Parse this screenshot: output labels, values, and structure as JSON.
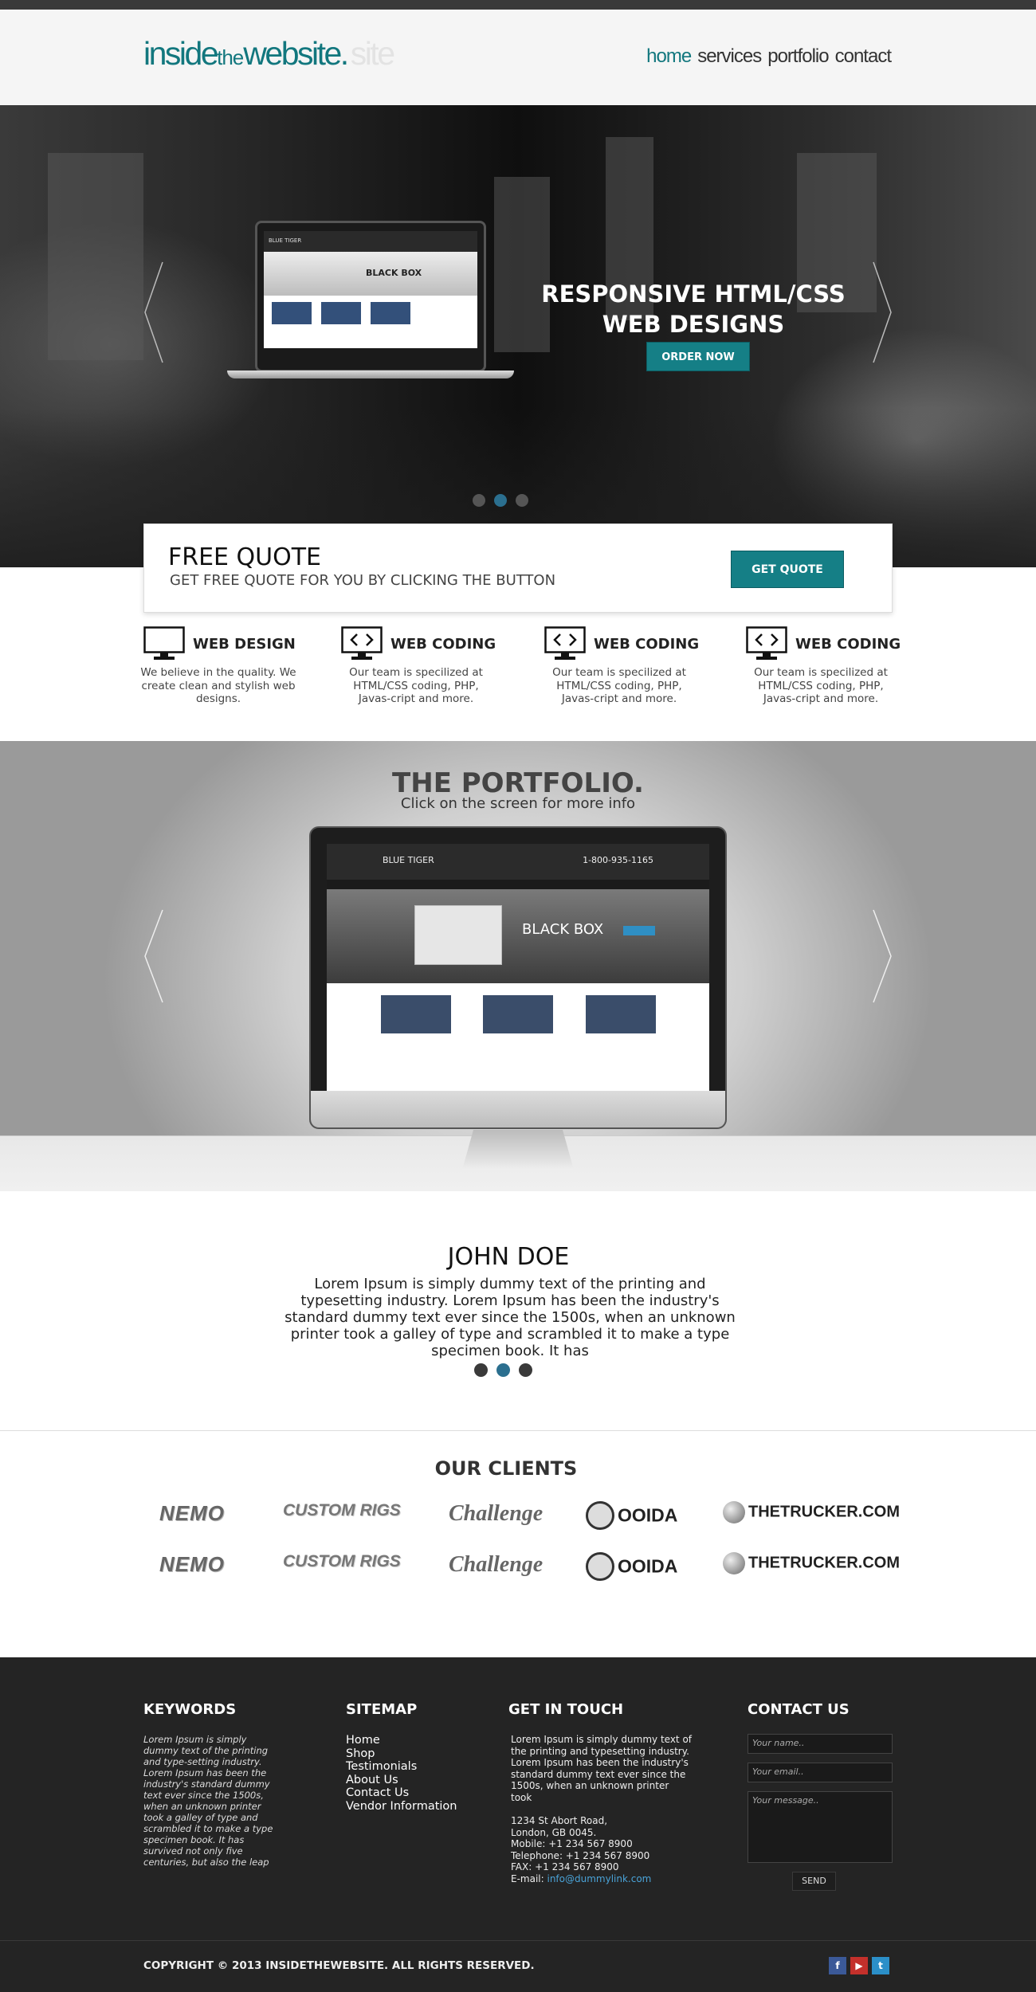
{
  "header": {
    "logo": {
      "part1": "inside",
      "part2": "the",
      "part3": "website.",
      "ghost": "site"
    },
    "nav": [
      "home",
      "services",
      "portfolio",
      "contact"
    ]
  },
  "hero": {
    "title_line1": "RESPONSIVE HTML/CSS",
    "title_line2": "WEB DESIGNS",
    "button": "ORDER NOW",
    "laptop_brand": "BLUE TIGER",
    "laptop_banner": "BLACK BOX"
  },
  "quote": {
    "title": "FREE QUOTE",
    "subtitle": "GET FREE QUOTE FOR YOU BY CLICKING THE BUTTON",
    "button": "GET QUOTE"
  },
  "services": [
    {
      "title": "WEB DESIGN",
      "text": "We believe in the quality. We create clean and stylish web designs.",
      "icon": "monitor-icon"
    },
    {
      "title": "WEB CODING",
      "text": "Our team is specilized at HTML/CSS coding, PHP, Javas-cript and more.",
      "icon": "code-monitor-icon"
    },
    {
      "title": "WEB CODING",
      "text": "Our team is specilized at HTML/CSS coding, PHP, Javas-cript and more.",
      "icon": "code-monitor-icon"
    },
    {
      "title": "WEB CODING",
      "text": "Our team is specilized at HTML/CSS coding, PHP, Javas-cript and more.",
      "icon": "code-monitor-icon"
    }
  ],
  "portfolio": {
    "title": "THE PORTFOLIO.",
    "subtitle": "Click on the screen for more info",
    "screen_brand": "BLUE TIGER",
    "screen_phone": "1-800-935-1165",
    "screen_banner": "BLACK BOX"
  },
  "testimonial": {
    "name": "JOHN DOE",
    "text": "Lorem Ipsum is simply dummy text of the printing and typesetting industry. Lorem Ipsum has been the industry's standard dummy text ever since the 1500s, when an unknown printer took a galley of type and scrambled it to make a type specimen book. It has"
  },
  "clients": {
    "title": "OUR CLIENTS",
    "logos": [
      "NEMO",
      "CUSTOM RIGS",
      "Challenge",
      "OOIDA",
      "THETRUCKER.COM"
    ]
  },
  "footer": {
    "keywords": {
      "title": "KEYWORDS",
      "text": "Lorem Ipsum is simply dummy text of the printing and type-setting industry. Lorem Ipsum has been the industry's standard dummy text ever since the 1500s, when an unknown printer took a galley of type and scrambled it to make a type specimen book. It has survived not only five centuries, but also the leap"
    },
    "sitemap": {
      "title": "SITEMAP",
      "links": [
        "Home",
        "Shop",
        "Testimonials",
        "About Us",
        "Contact Us",
        "Vendor Information"
      ]
    },
    "touch": {
      "title": "GET IN TOUCH",
      "text": "Lorem Ipsum is simply dummy text of the printing and typesetting industry. Lorem Ipsum has been the industry's standard dummy text ever since the 1500s, when an unknown printer took",
      "address1": "1234 St Abort Road,",
      "address2": "London, GB 0045.",
      "mobile": "Mobile: +1 234 567 8900",
      "telephone": "Telephone: +1 234 567 8900",
      "fax": "FAX: +1 234 567 8900",
      "email_label": "E-mail: ",
      "email": "info@dummylink.com"
    },
    "contact": {
      "title": "CONTACT US",
      "name_placeholder": "Your name..",
      "email_placeholder": "Your email..",
      "message_placeholder": "Your message..",
      "send": "SEND"
    }
  },
  "copyright": "COPYRIGHT © 2013 INSIDETHEWEBSITE. ALL RIGHTS RESERVED.",
  "social": [
    "f",
    "▶",
    "t"
  ],
  "colors": {
    "accent": "#157f86",
    "dark": "#242424",
    "dot_active": "#2b6f8f"
  }
}
